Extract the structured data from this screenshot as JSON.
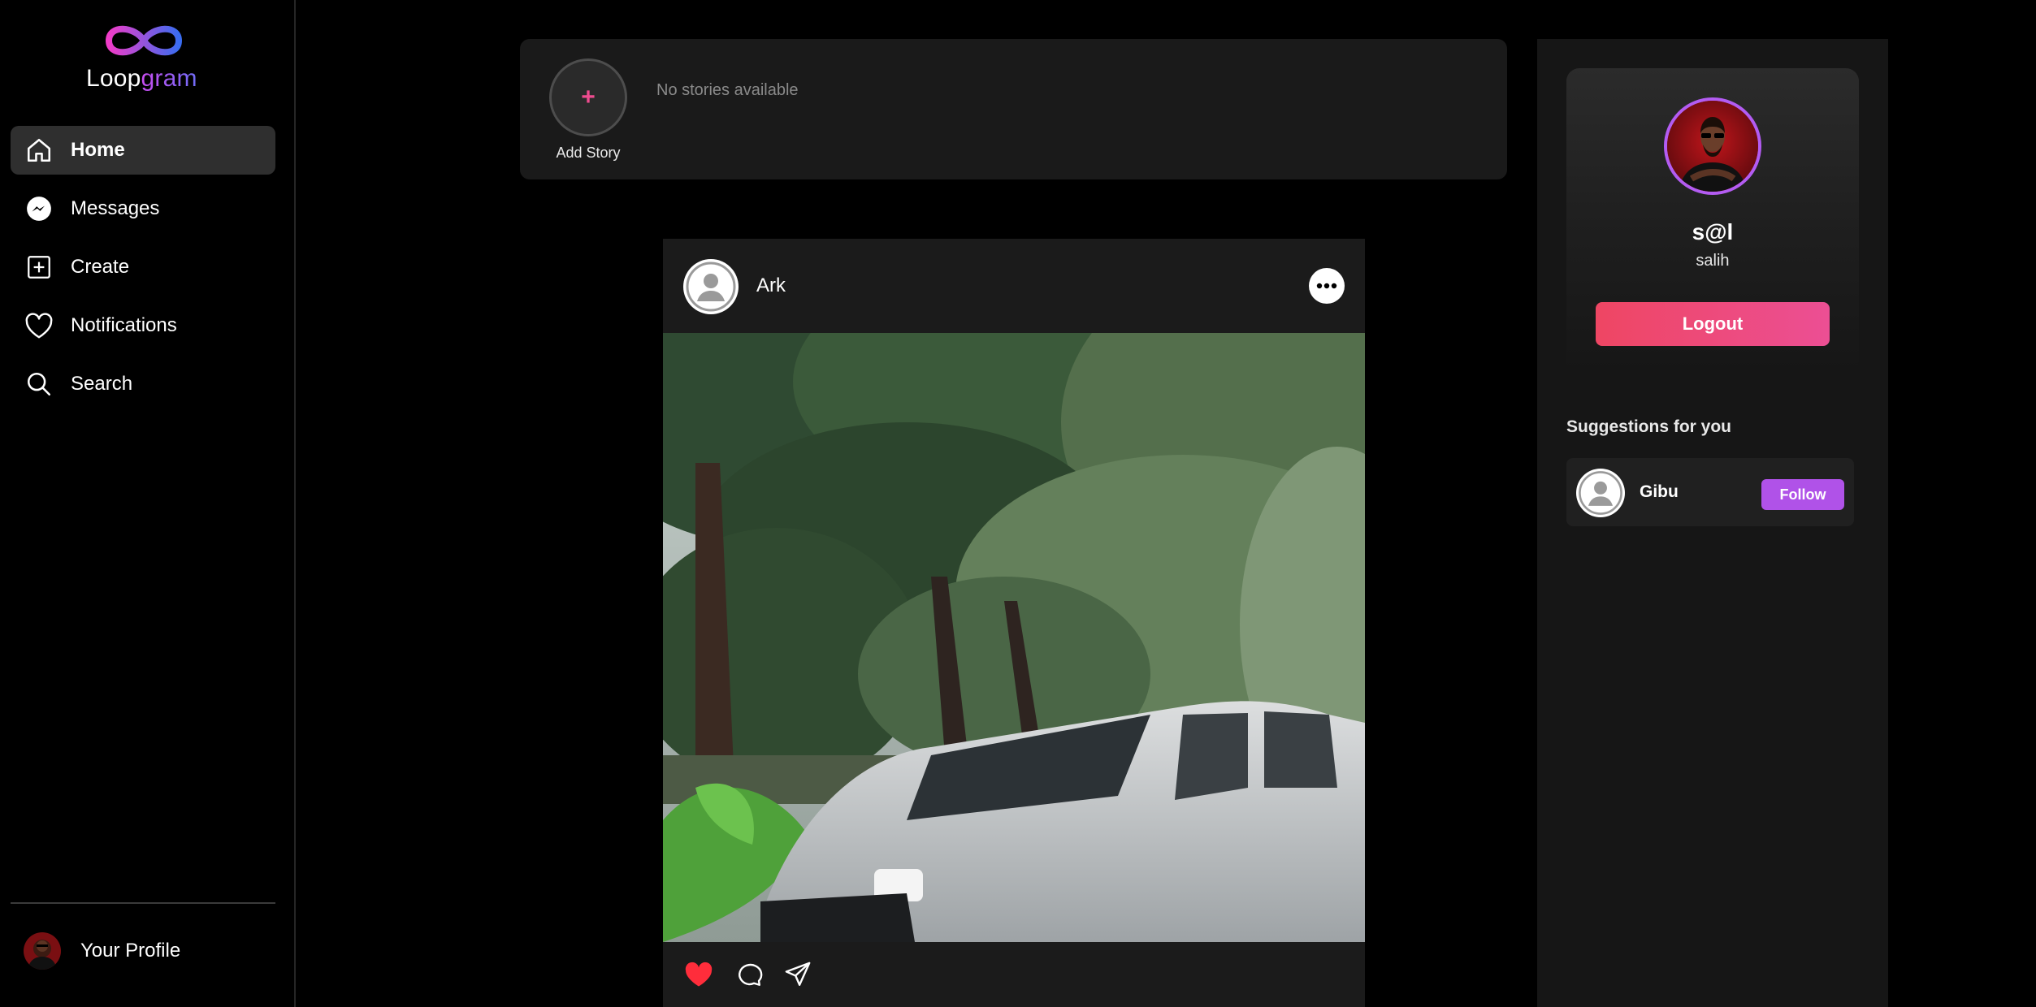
{
  "brand": {
    "part1": "Loop",
    "part2": "gram",
    "gradient_start": "#f03cc8",
    "gradient_end": "#3a6cf0"
  },
  "sidebar": {
    "items": [
      {
        "label": "Home",
        "icon": "home-icon",
        "active": true
      },
      {
        "label": "Messages",
        "icon": "messenger-icon"
      },
      {
        "label": "Create",
        "icon": "plus-square-icon"
      },
      {
        "label": "Notifications",
        "icon": "heart-icon"
      },
      {
        "label": "Search",
        "icon": "search-icon"
      }
    ],
    "profile_label": "Your Profile"
  },
  "stories": {
    "add_symbol": "+",
    "add_label": "Add Story",
    "empty_text": "No stories available"
  },
  "post": {
    "username": "Ark",
    "liked": true,
    "like_color": "#ff2d3b"
  },
  "profile": {
    "display_name": "s@l",
    "username": "salih",
    "logout_label": "Logout",
    "ring_color": "#b35cf2"
  },
  "suggestions": {
    "title": "Suggestions for you",
    "items": [
      {
        "name": "Gibu",
        "follow_label": "Follow"
      }
    ]
  }
}
